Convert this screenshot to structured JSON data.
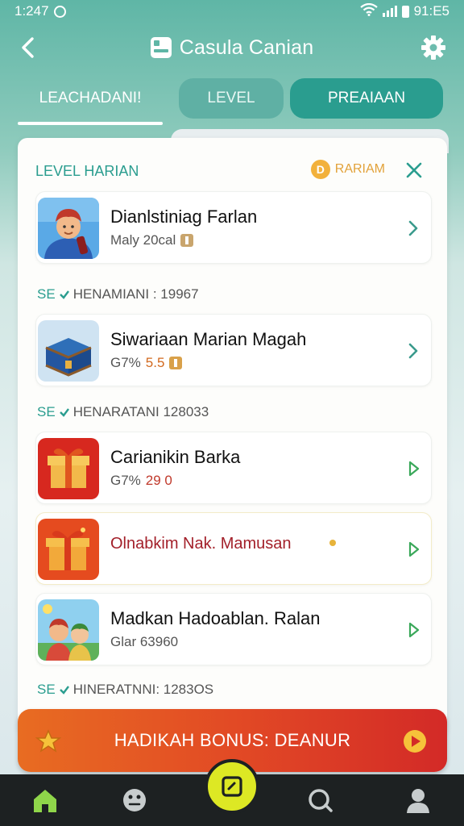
{
  "status_bar": {
    "time_left": "1:247",
    "time_right": "91:E5"
  },
  "header": {
    "title": "Casula Canian"
  },
  "tabs": [
    {
      "label": "LEACHADANI!"
    },
    {
      "label": "LEVEL"
    },
    {
      "label": "PREAIAAN"
    }
  ],
  "panel": {
    "title": "LEVEL HARIAN",
    "coin_label": "RARIAM",
    "coin_symbol": "D"
  },
  "items": [
    {
      "name": "Dianlstiniag Farlan",
      "sub_prefix": "Maly 20cal",
      "sub_value": ""
    },
    {
      "name": "Siwariaan Marian Magah",
      "sub_prefix": "G7%",
      "sub_value": "5.5"
    },
    {
      "name": "Carianikin Barka",
      "sub_prefix": "G7%",
      "sub_value": "29 0"
    },
    {
      "name": "Olnabkim Nak. Mamusan",
      "sub_prefix": "",
      "sub_value": ""
    },
    {
      "name": "Madkan Hadoablan. Ralan",
      "sub_prefix": "Glar 63960",
      "sub_value": ""
    }
  ],
  "sections": [
    {
      "prefix": "SE",
      "label": "HENAMIANI : 19967"
    },
    {
      "prefix": "SE",
      "label": "HENARATANI 128033"
    },
    {
      "prefix": "SE",
      "label": "HINERATNNI: 1283OS"
    }
  ],
  "bonus_button": {
    "label": "HADIKAH BONUS: DEANUR"
  },
  "colors": {
    "accent": "#2a9d8f",
    "bonus_start": "#e86c22",
    "bonus_end": "#d32a27",
    "nav_center": "#dde824"
  },
  "icons": [
    "back-arrow-icon",
    "app-logo-icon",
    "gear-icon",
    "close-icon",
    "chevron-right-icon",
    "home-icon",
    "game-icon",
    "scan-icon",
    "chat-icon",
    "profile-icon",
    "star-icon",
    "play-icon"
  ]
}
